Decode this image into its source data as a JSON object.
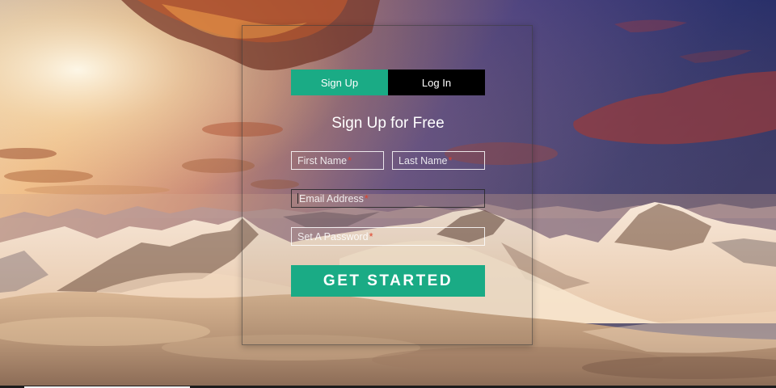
{
  "tabs": {
    "signup_label": "Sign Up",
    "login_label": "Log In",
    "active": "Sign Up"
  },
  "form": {
    "title": "Sign Up for Free",
    "first_name_placeholder": "First Name",
    "last_name_placeholder": "Last Name",
    "email_placeholder": "Email Address",
    "password_placeholder": "Set A Password",
    "required_mark": "*",
    "submit_label": "GET STARTED"
  },
  "colors": {
    "accent": "#1aab85",
    "inactive_tab": "#000000",
    "required": "#e0432b",
    "text": "#ffffff"
  },
  "background": {
    "scene": "sunset-mountains-above-clouds"
  }
}
